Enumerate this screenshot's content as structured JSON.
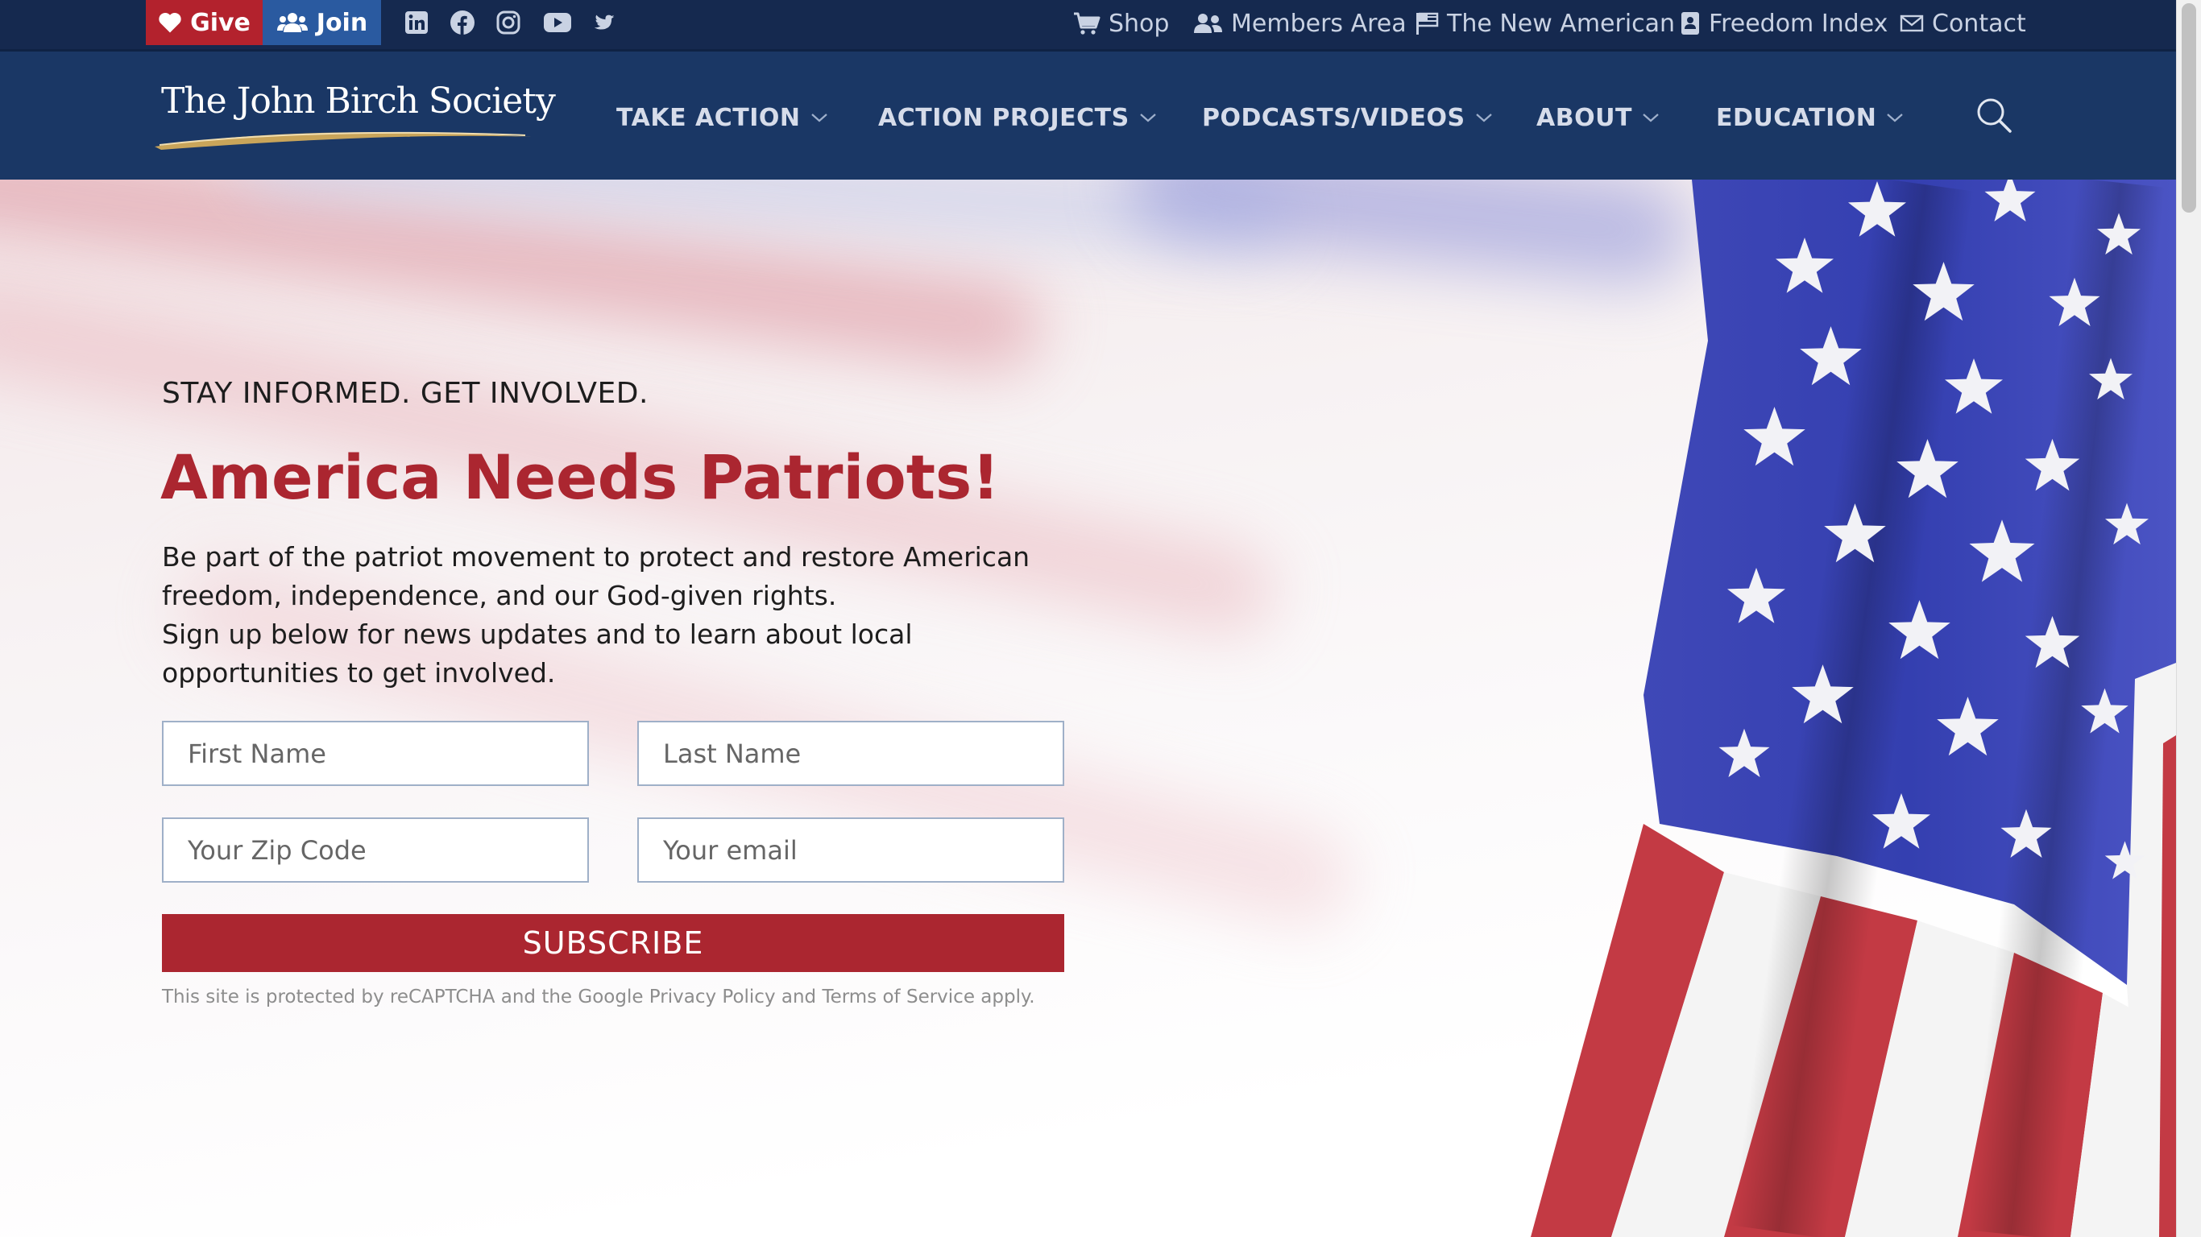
{
  "topbar": {
    "give_label": "Give",
    "join_label": "Join",
    "social": [
      "linkedin-icon",
      "facebook-icon",
      "instagram-icon",
      "youtube-icon",
      "twitter-icon"
    ],
    "links": [
      {
        "label": "Shop",
        "icon": "cart-icon"
      },
      {
        "label": "Members Area",
        "icon": "users-icon"
      },
      {
        "label": "The New American",
        "icon": "flag-icon"
      },
      {
        "label": "Freedom Index",
        "icon": "index-book-icon"
      },
      {
        "label": "Contact",
        "icon": "envelope-icon"
      }
    ]
  },
  "logo": {
    "text": "The John Birch Society"
  },
  "nav": {
    "items": [
      {
        "label": "TAKE ACTION"
      },
      {
        "label": "ACTION PROJECTS"
      },
      {
        "label": "PODCASTS/VIDEOS"
      },
      {
        "label": "ABOUT"
      },
      {
        "label": "EDUCATION"
      }
    ]
  },
  "hero": {
    "kicker": "STAY INFORMED. GET INVOLVED.",
    "headline": "America Needs Patriots!",
    "intro_line1": "Be part of the patriot movement to protect and restore American freedom, independence, and our God-given rights.",
    "intro_line2": "Sign up below for news updates and to learn about local opportunities to get involved."
  },
  "form": {
    "first_name_placeholder": "First Name",
    "last_name_placeholder": "Last Name",
    "zip_placeholder": "Your Zip Code",
    "email_placeholder": "Your email",
    "subscribe_label": "SUBSCRIBE",
    "legal": "This site is protected by reCAPTCHA and the Google Privacy Policy and Terms of Service apply."
  },
  "colors": {
    "navy": "#1a3765",
    "topbar": "#15294f",
    "give_red": "#b3222d",
    "join_blue": "#2a5aa0",
    "brand_red": "#ab2630"
  }
}
